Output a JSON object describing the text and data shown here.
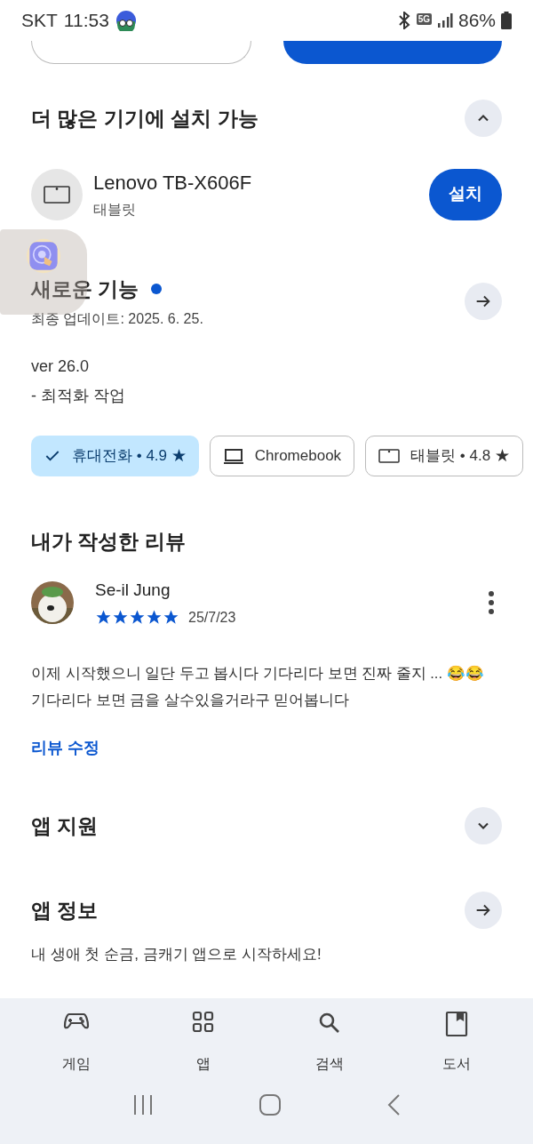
{
  "status_bar": {
    "carrier": "SKT",
    "time": "11:53",
    "network": "5G",
    "battery": "86%"
  },
  "top_buttons": [
    {
      "kind": "outline"
    },
    {
      "kind": "filled"
    }
  ],
  "install_more": {
    "title": "더 많은 기기에 설치 가능",
    "expanded": true,
    "devices": [
      {
        "name": "Lenovo TB-X606F",
        "type": "태블릿",
        "button": "설치"
      }
    ]
  },
  "whats_new": {
    "title": "새로운 기능",
    "new_dot": true,
    "updated": "최종 업데이트: 2025. 6. 25.",
    "notes": [
      "ver 26.0",
      "- 최적화 작업"
    ]
  },
  "device_chips": [
    {
      "kind": "phone",
      "label": "휴대전화 • 4.9 ★",
      "selected": true
    },
    {
      "kind": "laptop",
      "label": "Chromebook",
      "selected": false
    },
    {
      "kind": "tablet",
      "label": "태블릿 • 4.8 ★",
      "selected": false
    }
  ],
  "my_review": {
    "title": "내가 작성한 리뷰",
    "author": "Se-il Jung",
    "stars": 5,
    "date": "25/7/23",
    "lines": [
      "이제 시작했으니 일단 두고 봅시다 기다리다 보면 진짜 줄지 ... 😂😂",
      "기다리다 보면 금을 살수있을거라구 믿어봅니다"
    ],
    "edit": "리뷰 수정"
  },
  "sections": [
    {
      "title": "앱 지원",
      "kind": "expand",
      "expanded": false
    },
    {
      "title": "앱 정보",
      "kind": "arrow"
    }
  ],
  "about": "내 생애 첫 순금, 금캐기 앱으로 시작하세요!",
  "bottom_nav": [
    {
      "kind": "games",
      "label": "게임"
    },
    {
      "kind": "apps",
      "label": "앱"
    },
    {
      "kind": "search",
      "label": "검색"
    },
    {
      "kind": "books",
      "label": "도서"
    }
  ]
}
